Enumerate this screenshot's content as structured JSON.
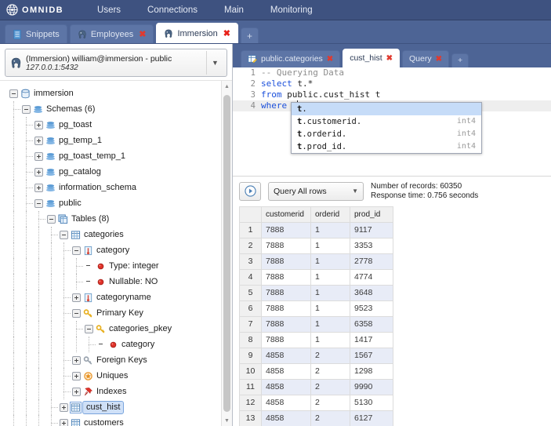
{
  "navbar": {
    "brand": "OMNIDB",
    "brand_icon": "globe-icon",
    "links": [
      "Users",
      "Connections",
      "Main",
      "Monitoring"
    ]
  },
  "outer_tabs": [
    {
      "label": "Snippets",
      "icon": "document-icon",
      "active": false,
      "closable": false
    },
    {
      "label": "Employees",
      "icon": "postgres-elephant-icon",
      "active": false,
      "closable": true
    },
    {
      "label": "Immersion",
      "icon": "postgres-elephant-icon",
      "active": true,
      "closable": true
    }
  ],
  "outer_tab_add": "+",
  "connection": {
    "icon": "postgres-elephant-icon",
    "title": "(Immersion) william@immersion - public",
    "host": "127.0.0.1:5432",
    "caret": "▼"
  },
  "tree": [
    {
      "label": "immersion",
      "depth": 0,
      "icon": "database-icon",
      "state": "open",
      "selected": false
    },
    {
      "label": "Schemas (6)",
      "depth": 1,
      "icon": "schemas-icon",
      "state": "open",
      "selected": false
    },
    {
      "label": "pg_toast",
      "depth": 2,
      "icon": "schema-icon",
      "state": "closed",
      "selected": false
    },
    {
      "label": "pg_temp_1",
      "depth": 2,
      "icon": "schema-icon",
      "state": "closed",
      "selected": false
    },
    {
      "label": "pg_toast_temp_1",
      "depth": 2,
      "icon": "schema-icon",
      "state": "closed",
      "selected": false
    },
    {
      "label": "pg_catalog",
      "depth": 2,
      "icon": "schema-icon",
      "state": "closed",
      "selected": false
    },
    {
      "label": "information_schema",
      "depth": 2,
      "icon": "schema-icon",
      "state": "closed",
      "selected": false
    },
    {
      "label": "public",
      "depth": 2,
      "icon": "schema-icon",
      "state": "open",
      "selected": false
    },
    {
      "label": "Tables (8)",
      "depth": 3,
      "icon": "tables-icon",
      "state": "open",
      "selected": false
    },
    {
      "label": "categories",
      "depth": 4,
      "icon": "table-icon",
      "state": "open",
      "selected": false
    },
    {
      "label": "category",
      "depth": 5,
      "icon": "column-icon",
      "state": "open",
      "selected": false
    },
    {
      "label": "Type: integer",
      "depth": 6,
      "icon": "property-icon",
      "state": "leaf",
      "selected": false
    },
    {
      "label": "Nullable: NO",
      "depth": 6,
      "icon": "property-icon",
      "state": "leaf",
      "selected": false
    },
    {
      "label": "categoryname",
      "depth": 5,
      "icon": "column-icon",
      "state": "closed",
      "selected": false
    },
    {
      "label": "Primary Key",
      "depth": 5,
      "icon": "key-icon",
      "state": "open",
      "selected": false
    },
    {
      "label": "categories_pkey",
      "depth": 6,
      "icon": "key-icon",
      "state": "open",
      "selected": false
    },
    {
      "label": "category",
      "depth": 7,
      "icon": "property-icon",
      "state": "leaf",
      "selected": false
    },
    {
      "label": "Foreign Keys",
      "depth": 5,
      "icon": "foreign-key-icon",
      "state": "closed",
      "selected": false
    },
    {
      "label": "Uniques",
      "depth": 5,
      "icon": "unique-icon",
      "state": "closed",
      "selected": false
    },
    {
      "label": "Indexes",
      "depth": 5,
      "icon": "index-pin-icon",
      "state": "closed",
      "selected": false
    },
    {
      "label": "cust_hist",
      "depth": 4,
      "icon": "table-icon",
      "state": "closed",
      "selected": true
    },
    {
      "label": "customers",
      "depth": 4,
      "icon": "table-icon",
      "state": "closed",
      "selected": false
    }
  ],
  "inner_tabs": [
    {
      "label": "public.categories",
      "icon": "table-edit-icon",
      "active": false,
      "closable": true
    },
    {
      "label": "cust_hist",
      "icon": "",
      "active": true,
      "closable": true
    },
    {
      "label": "Query",
      "icon": "",
      "active": false,
      "closable": true
    }
  ],
  "inner_tab_add": "+",
  "editor": {
    "lines": [
      {
        "num": "1",
        "parts": [
          {
            "t": "-- Querying Data",
            "c": "cmt"
          }
        ],
        "active": false
      },
      {
        "num": "2",
        "parts": [
          {
            "t": "select",
            "c": "kw"
          },
          {
            "t": " t.*",
            "c": ""
          }
        ],
        "active": false
      },
      {
        "num": "3",
        "parts": [
          {
            "t": "from",
            "c": "kw"
          },
          {
            "t": " public.cust_hist t",
            "c": ""
          }
        ],
        "active": false
      },
      {
        "num": "4",
        "parts": [
          {
            "t": "where",
            "c": "kw"
          },
          {
            "t": " t",
            "c": ""
          }
        ],
        "active": true
      }
    ]
  },
  "autocomplete": [
    {
      "prefix": "t",
      "rest": ".",
      "type": "",
      "selected": true
    },
    {
      "prefix": "t",
      "rest": ".customerid.",
      "type": "int4",
      "selected": false
    },
    {
      "prefix": "t",
      "rest": ".orderid.",
      "type": "int4",
      "selected": false
    },
    {
      "prefix": "t",
      "rest": ".prod_id.",
      "type": "int4",
      "selected": false
    }
  ],
  "results_toolbar": {
    "run_icon": "play-circle-icon",
    "rows_select_label": "Query All rows",
    "rows_select_caret": "▼",
    "records_line": "Number of records: 60350",
    "response_line": "Response time: 0.756 seconds"
  },
  "grid": {
    "columns": [
      "customerid",
      "orderid",
      "prod_id"
    ],
    "rows": [
      {
        "n": "1",
        "cells": [
          "7888",
          "1",
          "9117"
        ]
      },
      {
        "n": "2",
        "cells": [
          "7888",
          "1",
          "3353"
        ]
      },
      {
        "n": "3",
        "cells": [
          "7888",
          "1",
          "2778"
        ]
      },
      {
        "n": "4",
        "cells": [
          "7888",
          "1",
          "4774"
        ]
      },
      {
        "n": "5",
        "cells": [
          "7888",
          "1",
          "3648"
        ]
      },
      {
        "n": "6",
        "cells": [
          "7888",
          "1",
          "9523"
        ]
      },
      {
        "n": "7",
        "cells": [
          "7888",
          "1",
          "6358"
        ]
      },
      {
        "n": "8",
        "cells": [
          "7888",
          "1",
          "1417"
        ]
      },
      {
        "n": "9",
        "cells": [
          "4858",
          "2",
          "1567"
        ]
      },
      {
        "n": "10",
        "cells": [
          "4858",
          "2",
          "1298"
        ]
      },
      {
        "n": "11",
        "cells": [
          "4858",
          "2",
          "9990"
        ]
      },
      {
        "n": "12",
        "cells": [
          "4858",
          "2",
          "5130"
        ]
      },
      {
        "n": "13",
        "cells": [
          "4858",
          "2",
          "6127"
        ]
      }
    ]
  },
  "colors": {
    "navbar": "#3e5280",
    "tabbar": "#4d6495",
    "accent_blue": "#1a4fdb",
    "close_red": "#e03a2f",
    "row_alt": "#e8ecf7",
    "selection": "#cfe0f7"
  }
}
